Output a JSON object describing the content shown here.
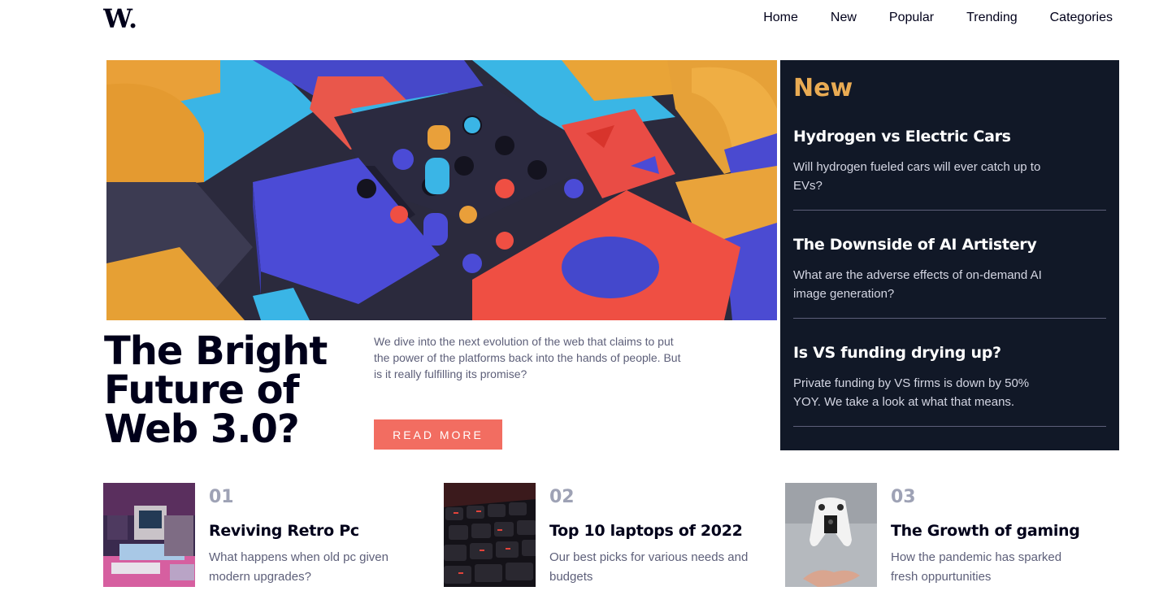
{
  "brand": {
    "logo_text": "W."
  },
  "nav": {
    "items": [
      {
        "label": "Home"
      },
      {
        "label": "New"
      },
      {
        "label": "Popular"
      },
      {
        "label": "Trending"
      },
      {
        "label": "Categories"
      }
    ]
  },
  "hero": {
    "title": "The Bright Future of Web 3.0?",
    "description": "We dive into the next evolution of the web that claims to put the power of the platforms back into the hands of people. But is it really fulfilling its promise?",
    "button_label": "READ MORE"
  },
  "new_panel": {
    "heading": "New",
    "items": [
      {
        "title": "Hydrogen vs Electric Cars",
        "text": "Will hydrogen fueled cars will ever catch up to EVs?"
      },
      {
        "title": "The Downside of AI Artistery",
        "text": "What are the adverse effects of on-demand AI image generation?"
      },
      {
        "title": "Is VS funding drying up?",
        "text": "Private funding by VS firms is down by 50% YOY. We take a look at what that means."
      }
    ]
  },
  "cards": [
    {
      "number": "01",
      "title": "Reviving Retro Pc",
      "text": "What happens when old pc given modern upgrades?"
    },
    {
      "number": "02",
      "title": "Top 10 laptops of 2022",
      "text": "Our best picks for various needs and budgets"
    },
    {
      "number": "03",
      "title": "The Growth of gaming",
      "text": "How the pandemic has sparked fresh oppurtunities"
    }
  ],
  "colors": {
    "accent": "#f15e50",
    "new_heading": "#e9ab53",
    "panel_bg": "#111827",
    "text_dark": "#00001a",
    "text_muted": "#5d5f79"
  }
}
